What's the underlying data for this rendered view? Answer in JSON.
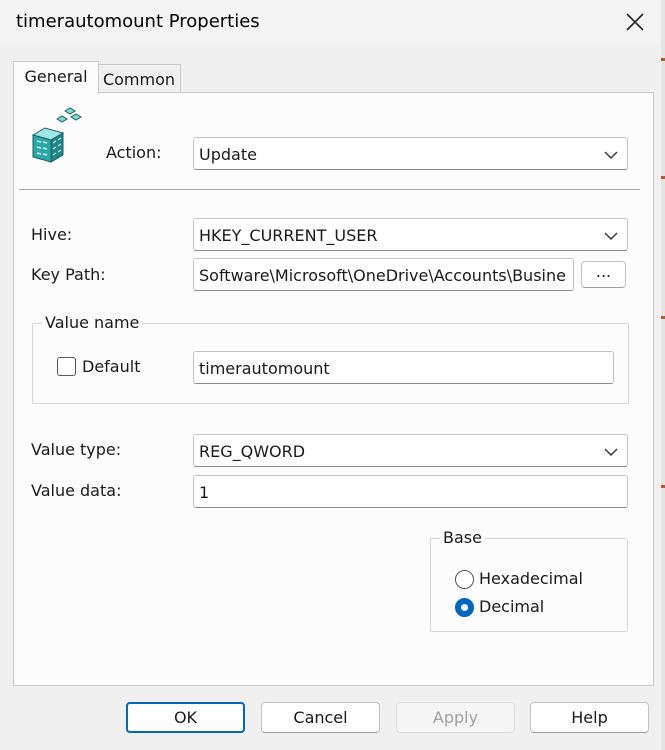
{
  "window": {
    "title": "timerautomount Properties"
  },
  "tabs": [
    {
      "label": "General",
      "active": true
    },
    {
      "label": "Common",
      "active": false
    }
  ],
  "icons": {
    "header_icon": "registry-cubes-icon",
    "close": "close-icon",
    "dropdown": "chevron-down-icon"
  },
  "colors": {
    "accent": "#0067c0",
    "icon_teal": "#2aa7a7"
  },
  "general": {
    "action": {
      "label": "Action:",
      "value": "Update"
    },
    "hive": {
      "label": "Hive:",
      "value": "HKEY_CURRENT_USER"
    },
    "key_path": {
      "label": "Key Path:",
      "value": "Software\\Microsoft\\OneDrive\\Accounts\\Busine",
      "browse_label": "..."
    },
    "value_name": {
      "caption": "Value name",
      "default_label": "Default",
      "default_checked": false,
      "value": "timerautomount"
    },
    "value_type": {
      "label": "Value type:",
      "value": "REG_QWORD"
    },
    "value_data": {
      "label": "Value data:",
      "value": "1"
    },
    "base": {
      "caption": "Base",
      "options": [
        {
          "label": "Hexadecimal",
          "selected": false
        },
        {
          "label": "Decimal",
          "selected": true
        }
      ]
    }
  },
  "buttons": {
    "ok": "OK",
    "cancel": "Cancel",
    "apply": "Apply",
    "help": "Help"
  }
}
